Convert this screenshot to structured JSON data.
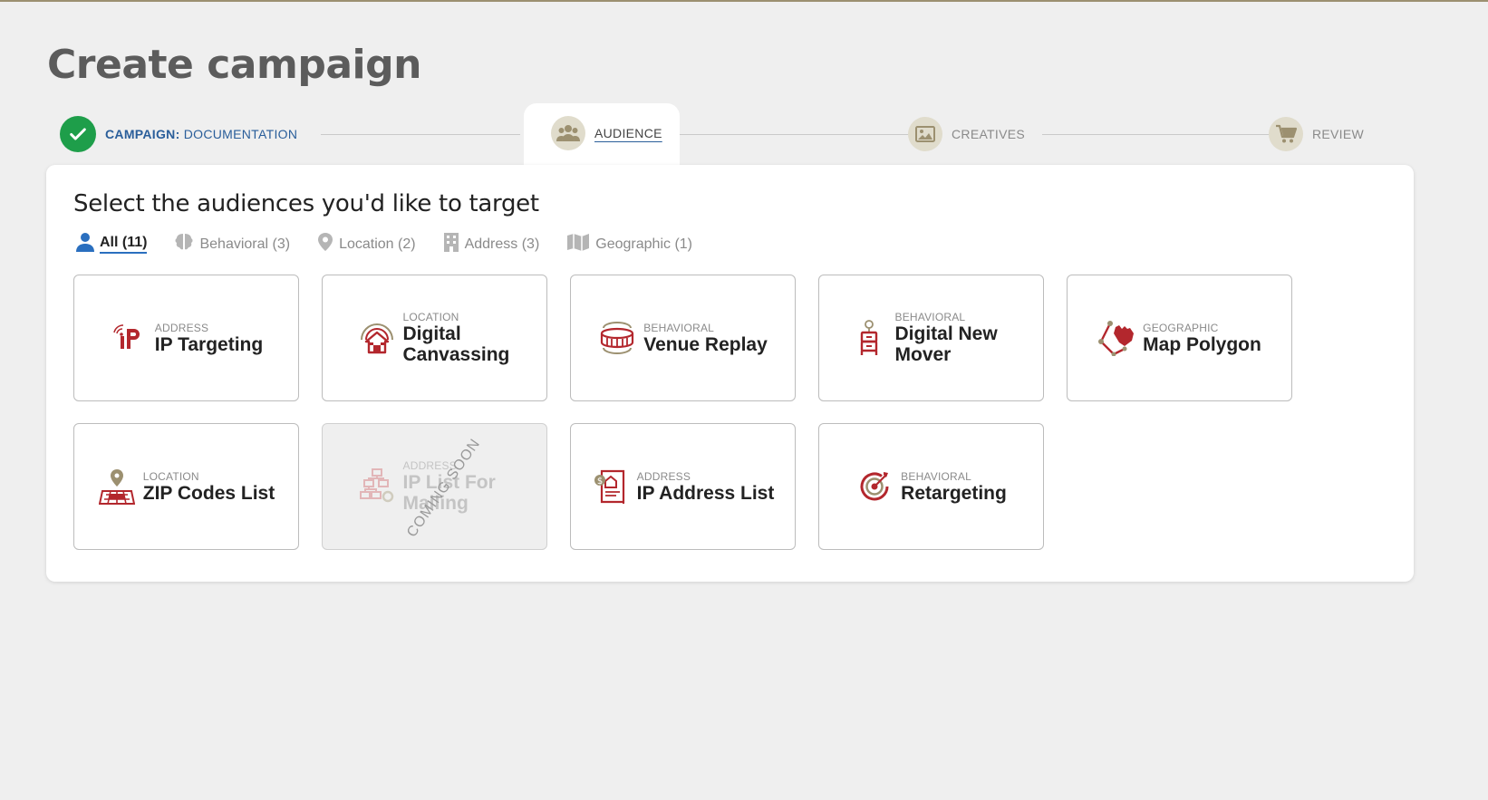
{
  "page_title": "Create campaign",
  "stepper": {
    "steps": [
      {
        "prefix": "CAMPAIGN:",
        "label": "DOCUMENTATION",
        "state": "done"
      },
      {
        "label": "AUDIENCE",
        "state": "active",
        "icon": "users-icon"
      },
      {
        "label": "CREATIVES",
        "state": "pending",
        "icon": "image-icon"
      },
      {
        "label": "REVIEW",
        "state": "pending",
        "icon": "cart-icon"
      }
    ]
  },
  "panel": {
    "heading": "Select the audiences you'd like to target",
    "filters": [
      {
        "label": "All (11)",
        "icon": "person-icon",
        "active": true
      },
      {
        "label": "Behavioral (3)",
        "icon": "brain-icon",
        "active": false
      },
      {
        "label": "Location (2)",
        "icon": "map-pin-icon",
        "active": false
      },
      {
        "label": "Address (3)",
        "icon": "building-icon",
        "active": false
      },
      {
        "label": "Geographic (1)",
        "icon": "map-icon",
        "active": false
      }
    ],
    "cards": [
      {
        "category": "ADDRESS",
        "title": "IP Targeting",
        "icon": "ip-signal-icon"
      },
      {
        "category": "LOCATION",
        "title": "Digital Canvassing",
        "icon": "house-radar-icon"
      },
      {
        "category": "BEHAVIORAL",
        "title": "Venue Replay",
        "icon": "stadium-icon"
      },
      {
        "category": "BEHAVIORAL",
        "title": "Digital New Mover",
        "icon": "moving-dolly-icon"
      },
      {
        "category": "GEOGRAPHIC",
        "title": "Map Polygon",
        "icon": "polygon-hand-icon"
      },
      {
        "category": "LOCATION",
        "title": "ZIP Codes List",
        "icon": "zip-pin-icon"
      },
      {
        "category": "ADDRESS",
        "title": "IP List For Mailing",
        "icon": "network-gear-icon",
        "disabled": true,
        "badge": "COMING SOON"
      },
      {
        "category": "ADDRESS",
        "title": "IP Address List",
        "icon": "document-list-icon"
      },
      {
        "category": "BEHAVIORAL",
        "title": "Retargeting",
        "icon": "target-icon"
      }
    ]
  },
  "colors": {
    "accent_blue": "#2a5e9a",
    "success_green": "#1e9e4a",
    "icon_red": "#b3272d",
    "step_icon_bg": "#e0dccc"
  }
}
